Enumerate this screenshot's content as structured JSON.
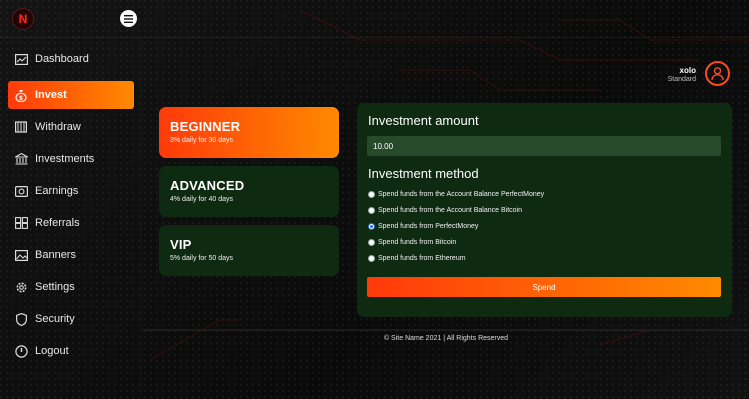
{
  "brand": {
    "logo_letter": "N"
  },
  "sidebar": {
    "items": [
      {
        "label": "Dashboard",
        "icon": "dashboard-icon",
        "active": false
      },
      {
        "label": "Invest",
        "icon": "money-bag-icon",
        "active": true
      },
      {
        "label": "Withdraw",
        "icon": "withdraw-icon",
        "active": false
      },
      {
        "label": "Investments",
        "icon": "bank-icon",
        "active": false
      },
      {
        "label": "Earnings",
        "icon": "earnings-icon",
        "active": false
      },
      {
        "label": "Referrals",
        "icon": "referrals-icon",
        "active": false
      },
      {
        "label": "Banners",
        "icon": "image-icon",
        "active": false
      },
      {
        "label": "Settings",
        "icon": "gear-icon",
        "active": false
      },
      {
        "label": "Security",
        "icon": "shield-icon",
        "active": false
      },
      {
        "label": "Logout",
        "icon": "power-icon",
        "active": false
      }
    ]
  },
  "user": {
    "name": "xolo",
    "tier": "Standard"
  },
  "plans": [
    {
      "title": "BEGINNER",
      "desc": "3% daily for 30 days",
      "selected": true
    },
    {
      "title": "ADVANCED",
      "desc": "4% daily for 40 days",
      "selected": false
    },
    {
      "title": "VIP",
      "desc": "5% daily for 50 days",
      "selected": false
    }
  ],
  "invest": {
    "amount_heading": "Investment amount",
    "amount_value": "10.00",
    "method_heading": "Investment method",
    "methods": [
      {
        "label": "Spend funds from the Account Balance PerfectMoney",
        "checked": false
      },
      {
        "label": "Spend funds from the Account Balance Bitcoin",
        "checked": false
      },
      {
        "label": "Spend funds from PerfectMoney",
        "checked": true
      },
      {
        "label": "Spend funds from Bitcoin",
        "checked": false
      },
      {
        "label": "Spend funds from Ethereum",
        "checked": false
      }
    ],
    "submit_label": "Spend"
  },
  "footer": {
    "text": "© Site Name 2021 | All Rights Reserved"
  },
  "colors": {
    "accent_start": "#ff3a0a",
    "accent_end": "#ff8a00",
    "panel_green": "#0e2a10",
    "input_green": "#274a2a"
  }
}
